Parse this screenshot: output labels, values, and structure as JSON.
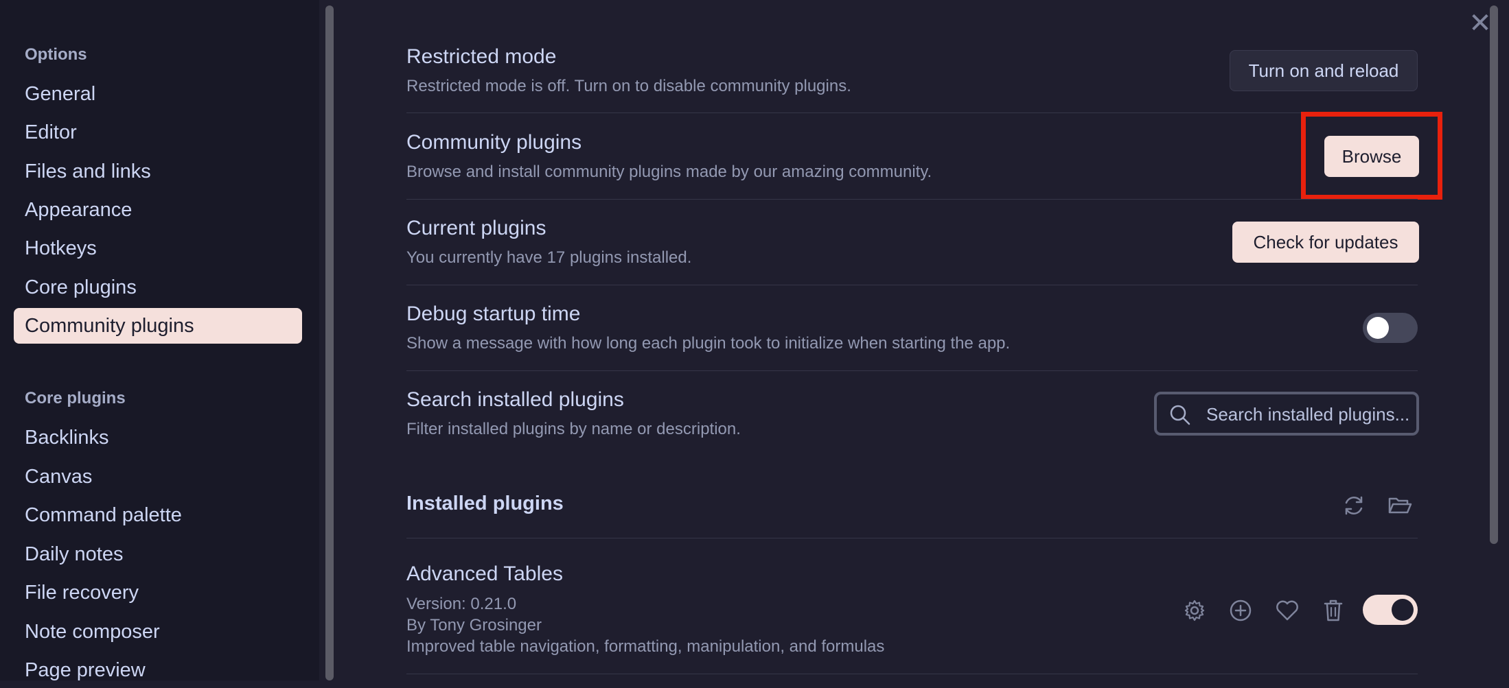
{
  "sidebar": {
    "options_heading": "Options",
    "options_items": [
      "General",
      "Editor",
      "Files and links",
      "Appearance",
      "Hotkeys",
      "Core plugins",
      "Community plugins"
    ],
    "active_item": "Community plugins",
    "core_heading": "Core plugins",
    "core_items": [
      "Backlinks",
      "Canvas",
      "Command palette",
      "Daily notes",
      "File recovery",
      "Note composer",
      "Page preview"
    ]
  },
  "settings": {
    "restricted": {
      "title": "Restricted mode",
      "desc": "Restricted mode is off. Turn on to disable community plugins.",
      "button": "Turn on and reload"
    },
    "community": {
      "title": "Community plugins",
      "desc": "Browse and install community plugins made by our amazing community.",
      "button": "Browse"
    },
    "current": {
      "title": "Current plugins",
      "desc": "You currently have 17 plugins installed.",
      "button": "Check for updates"
    },
    "debug": {
      "title": "Debug startup time",
      "desc": "Show a message with how long each plugin took to initialize when starting the app.",
      "enabled": false
    },
    "search": {
      "title": "Search installed plugins",
      "desc": "Filter installed plugins by name or description.",
      "placeholder": "Search installed plugins..."
    }
  },
  "installed": {
    "heading": "Installed plugins",
    "plugins": [
      {
        "name": "Advanced Tables",
        "version": "Version: 0.21.0",
        "author": "By Tony Grosinger",
        "desc": "Improved table navigation, formatting, manipulation, and formulas",
        "enabled": true
      }
    ]
  },
  "colors": {
    "accent": "#f5e0dc",
    "highlight": "#e8210d",
    "background": "#1f1e2e",
    "sidebar_bg": "#181826"
  }
}
